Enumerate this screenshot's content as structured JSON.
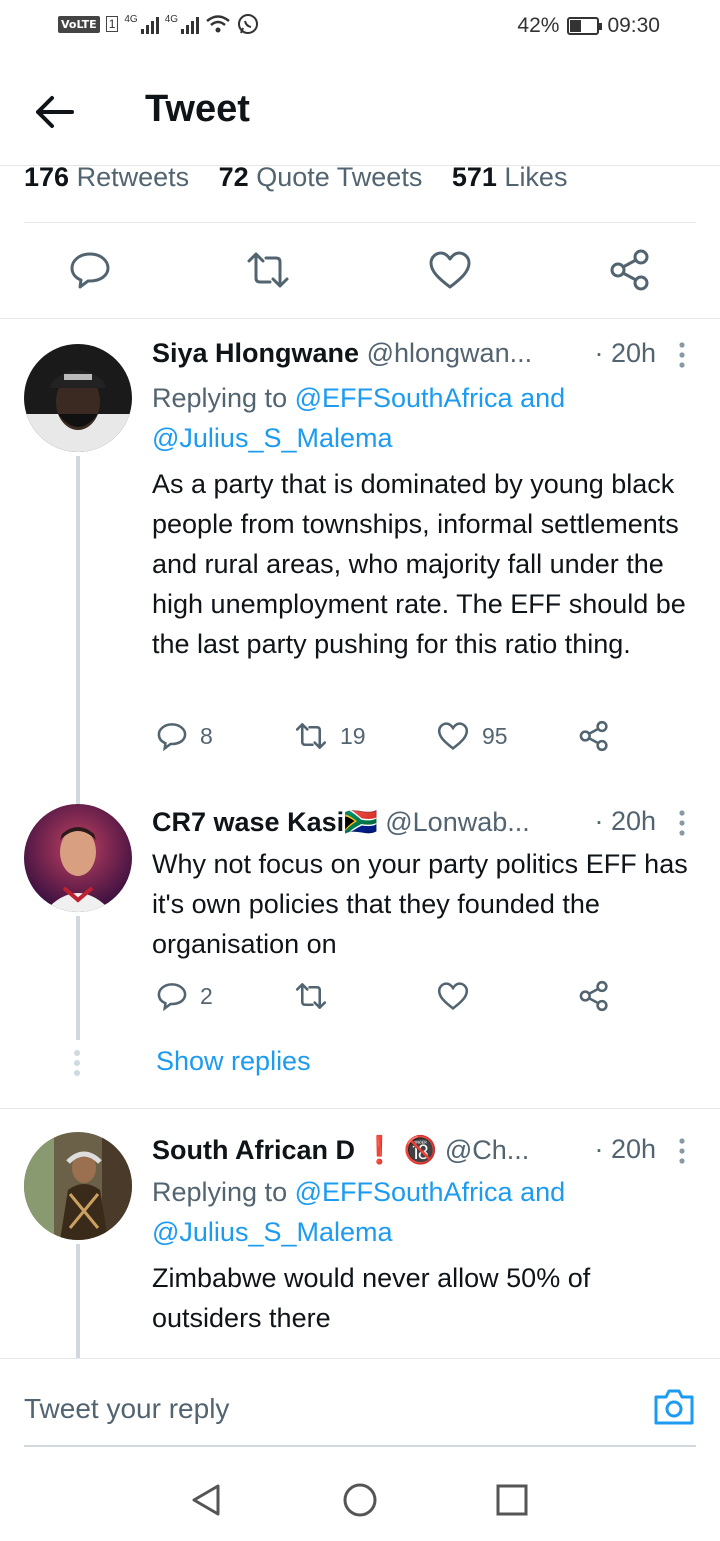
{
  "status_bar": {
    "volte": "VoLTE",
    "sim": "1",
    "net1": "4G",
    "net2": "4G",
    "battery_text": "42%",
    "battery_level": 0.42,
    "time": "09:30"
  },
  "header": {
    "title": "Tweet"
  },
  "stats": {
    "retweets_count": "176",
    "retweets_label": "Retweets",
    "quotes_count": "72",
    "quotes_label": "Quote Tweets",
    "likes_count": "571",
    "likes_label": "Likes"
  },
  "replies": [
    {
      "name": "Siya Hlongwane",
      "handle": "@hlongwan...",
      "time": "· 20h",
      "replying_prefix": "Replying to ",
      "mention1": "@EFFSouthAfrica",
      "and": " and",
      "mention2": "@Julius_S_Malema",
      "body": "As a party that is dominated by young black people from townships, informal settlements and rural areas,  who majority fall under the high unemployment rate. The EFF should be the last party pushing for this ratio thing.",
      "reply_count": "8",
      "retweet_count": "19",
      "like_count": "95"
    },
    {
      "name": "CR7 wase Kasi",
      "flag": "🇿🇦",
      "handle": "@Lonwab...",
      "time": "· 20h",
      "body": "Why not focus on your party politics EFF has it's own policies that they founded the organisation on",
      "reply_count": "2",
      "retweet_count": "",
      "like_count": "",
      "show_replies": "Show replies"
    },
    {
      "name": "South African D",
      "badge1": "❗",
      "badge2": "🔞",
      "handle": "@Ch...",
      "time": "· 20h",
      "replying_prefix": "Replying to ",
      "mention1": "@EFFSouthAfrica",
      "and": " and",
      "mention2": "@Julius_S_Malema",
      "body": "Zimbabwe would never allow 50% of outsiders there"
    }
  ],
  "compose": {
    "placeholder": "Tweet your reply"
  },
  "colors": {
    "accent": "#1d9bf0",
    "secondary_text": "#536471",
    "primary_text": "#0f1419",
    "thread_line": "#cfd9de"
  }
}
